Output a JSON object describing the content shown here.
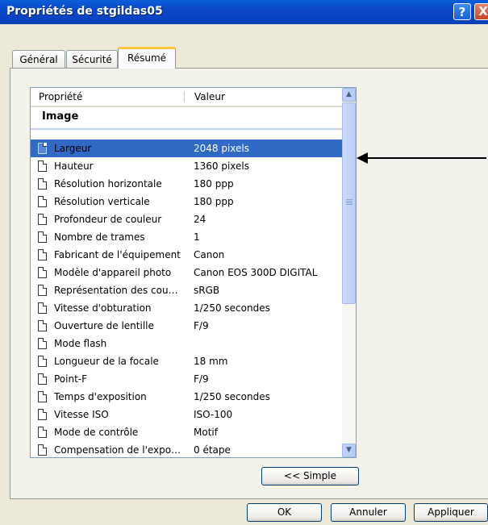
{
  "window": {
    "title": "Propriétés de stgildas05",
    "help_label": "?",
    "close_label": "X"
  },
  "tabs": [
    {
      "label": "Général",
      "active": false
    },
    {
      "label": "Sécurité",
      "active": false
    },
    {
      "label": "Résumé",
      "active": true
    }
  ],
  "table": {
    "headers": {
      "property": "Propriété",
      "value": "Valeur"
    },
    "group": "Image",
    "rows": [
      {
        "name": "Largeur",
        "value": "2048 pixels",
        "selected": true
      },
      {
        "name": "Hauteur",
        "value": "1360 pixels"
      },
      {
        "name": "Résolution horizontale",
        "value": "180 ppp"
      },
      {
        "name": "Résolution verticale",
        "value": "180 ppp"
      },
      {
        "name": "Profondeur de couleur",
        "value": "24"
      },
      {
        "name": "Nombre de trames",
        "value": "1"
      },
      {
        "name": "Fabricant de l'équipement",
        "value": "Canon"
      },
      {
        "name": "Modèle d'appareil photo",
        "value": "Canon EOS 300D DIGITAL"
      },
      {
        "name": "Représentation des cou…",
        "value": "sRGB"
      },
      {
        "name": "Vitesse d'obturation",
        "value": "1/250 secondes"
      },
      {
        "name": "Ouverture de lentille",
        "value": "F/9"
      },
      {
        "name": "Mode flash",
        "value": ""
      },
      {
        "name": "Longueur de la focale",
        "value": "18 mm"
      },
      {
        "name": "Point-F",
        "value": "F/9"
      },
      {
        "name": "Temps d'exposition",
        "value": "1/250 secondes"
      },
      {
        "name": "Vitesse ISO",
        "value": "ISO-100"
      },
      {
        "name": "Mode de contrôle",
        "value": "Motif"
      },
      {
        "name": "Compensation de l'expo…",
        "value": "0 étape"
      }
    ]
  },
  "buttons": {
    "simple": "<< Simple",
    "ok": "OK",
    "cancel": "Annuler",
    "apply": "Appliquer"
  },
  "icons": {
    "row_icon": "document-icon",
    "scroll_up": "chevron-up-icon",
    "scroll_down": "chevron-down-icon",
    "annotation": "arrow-left-icon"
  },
  "colors": {
    "selection": "#316ac5",
    "titlebar": "#0a47c8"
  }
}
